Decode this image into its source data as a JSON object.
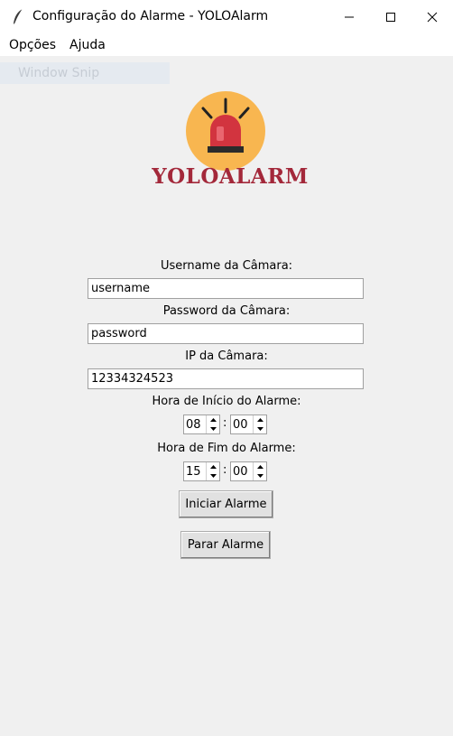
{
  "window": {
    "title": "Configuração do Alarme - YOLOAlarm",
    "app_icon": "feather-icon"
  },
  "menu": {
    "items": [
      "Opções",
      "Ajuda"
    ]
  },
  "overlay": {
    "snip_label": "Window Snip"
  },
  "logo": {
    "text": "YOLOALARM",
    "icon": "siren-icon",
    "colors": {
      "circle": "#f8b650",
      "siren": "#d2343f",
      "text": "#a3283a"
    }
  },
  "form": {
    "username_label": "Username da Câmara:",
    "username_value": "username",
    "password_label": "Password da Câmara:",
    "password_value": "password",
    "ip_label": "IP da Câmara:",
    "ip_value": "12334324523",
    "start_label": "Hora de Início do Alarme:",
    "start_hour": "08",
    "start_minute": "00",
    "end_label": "Hora de Fim do Alarme:",
    "end_hour": "15",
    "end_minute": "00",
    "separator": ":"
  },
  "buttons": {
    "start": "Iniciar Alarme",
    "stop": "Parar Alarme"
  }
}
